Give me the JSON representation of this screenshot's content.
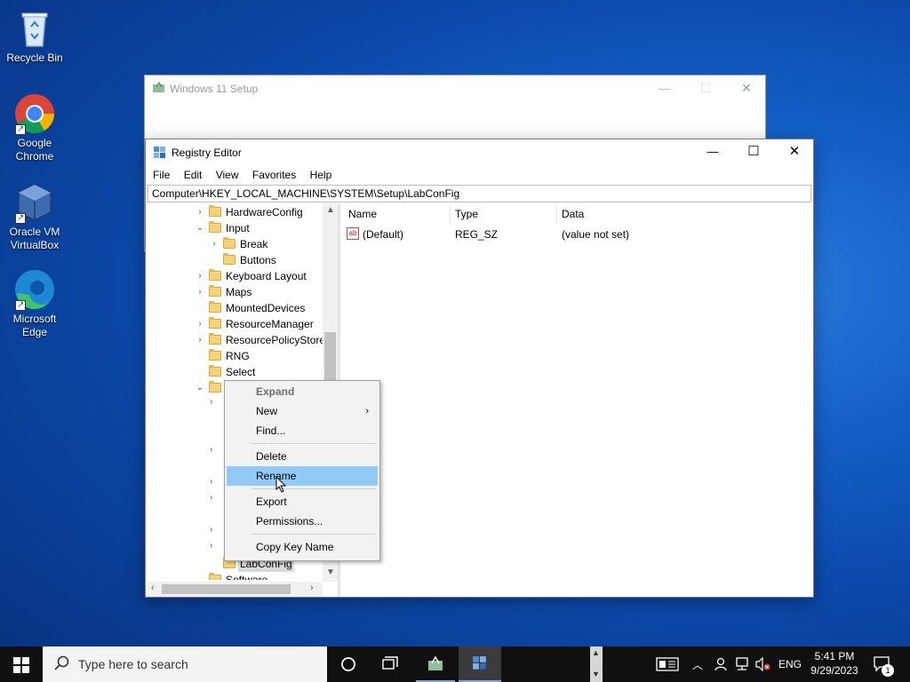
{
  "desktop": {
    "icons": [
      {
        "label": "Recycle Bin"
      },
      {
        "label": "Google Chrome"
      },
      {
        "label": "Oracle VM VirtualBox"
      },
      {
        "label": "Microsoft Edge"
      }
    ]
  },
  "setup_window": {
    "title": "Windows 11 Setup"
  },
  "regedit": {
    "title": "Registry Editor",
    "menu": [
      "File",
      "Edit",
      "View",
      "Favorites",
      "Help"
    ],
    "address": "Computer\\HKEY_LOCAL_MACHINE\\SYSTEM\\Setup\\LabConFig",
    "tree": [
      {
        "label": "HardwareConfig"
      },
      {
        "label": "Input"
      },
      {
        "label": "Break"
      },
      {
        "label": "Buttons"
      },
      {
        "label": "Keyboard Layout"
      },
      {
        "label": "Maps"
      },
      {
        "label": "MountedDevices"
      },
      {
        "label": "ResourceManager"
      },
      {
        "label": "ResourcePolicyStore"
      },
      {
        "label": "RNG"
      },
      {
        "label": "Select"
      },
      {
        "label": "LabConFig"
      },
      {
        "label": "Software"
      }
    ],
    "columns": {
      "name": "Name",
      "type": "Type",
      "data": "Data"
    },
    "values": [
      {
        "name": "(Default)",
        "type": "REG_SZ",
        "data": "(value not set)"
      }
    ]
  },
  "context_menu": {
    "items": [
      "Expand",
      "New",
      "Find...",
      "Delete",
      "Rename",
      "Export",
      "Permissions...",
      "Copy Key Name"
    ],
    "highlighted": "Rename"
  },
  "taskbar": {
    "search_placeholder": "Type here to search",
    "language": "ENG",
    "time": "5:41 PM",
    "date": "9/29/2023",
    "notification_count": "1"
  },
  "colors": {
    "highlight": "#91c9f7",
    "taskbar": "#101010"
  }
}
